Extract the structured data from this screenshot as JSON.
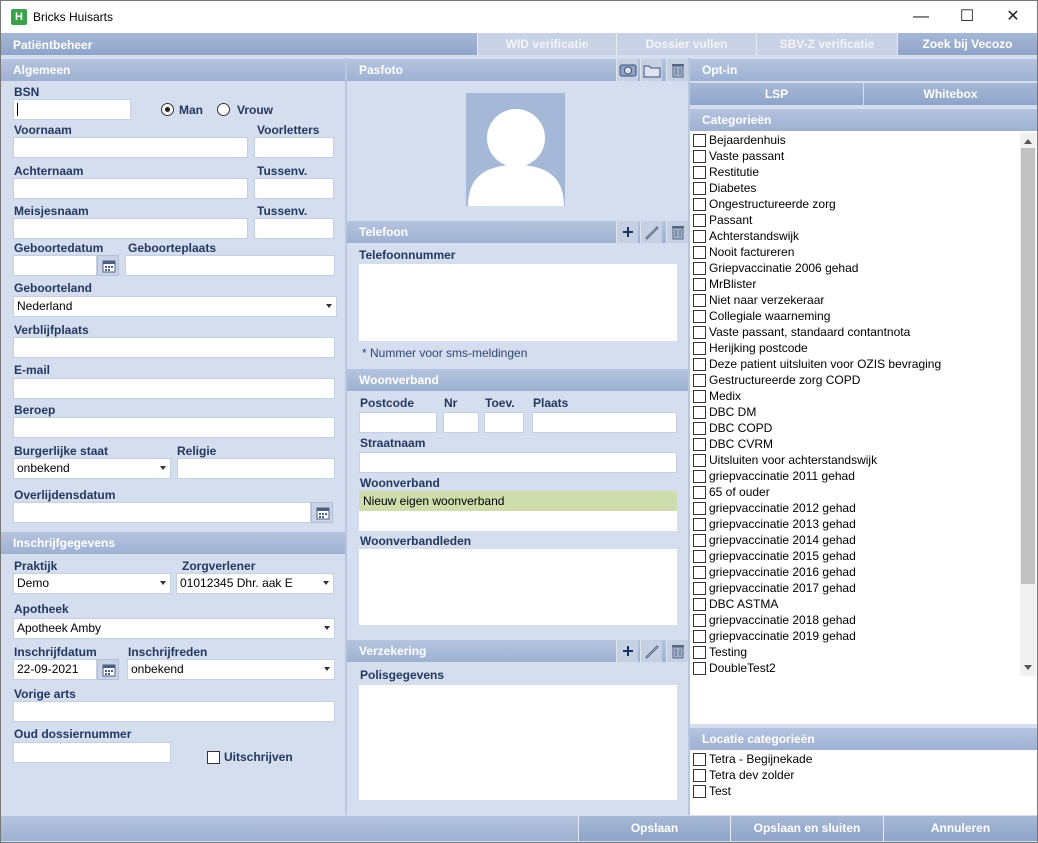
{
  "window": {
    "title": "Bricks Huisarts",
    "app_icon": "H",
    "minimize": "—",
    "maximize": "☐",
    "close": "✕"
  },
  "header": {
    "title": "Patiëntbeheer",
    "buttons": [
      "WID verificatie",
      "Dossier vullen",
      "SBV-Z verificatie",
      "Zoek bij Vecozo"
    ]
  },
  "algemeen": {
    "title": "Algemeen",
    "bsn_label": "BSN",
    "bsn_value": "",
    "gender_man": "Man",
    "gender_vrouw": "Vrouw",
    "voornaam_label": "Voornaam",
    "voorletters_label": "Voorletters",
    "achternaam_label": "Achternaam",
    "tussenv_label": "Tussenv.",
    "meisjesnaam_label": "Meisjesnaam",
    "tussenv2_label": "Tussenv.",
    "geboortedatum_label": "Geboortedatum",
    "geboorteplaats_label": "Geboorteplaats",
    "geboorteland_label": "Geboorteland",
    "geboorteland_value": "Nederland",
    "verblijfplaats_label": "Verblijfplaats",
    "email_label": "E-mail",
    "beroep_label": "Beroep",
    "burgerlijke_label": "Burgerlijke staat",
    "burgerlijke_value": "onbekend",
    "religie_label": "Religie",
    "overlijdensdatum_label": "Overlijdensdatum"
  },
  "inschrijf": {
    "title": "Inschrijfgegevens",
    "praktijk_label": "Praktijk",
    "praktijk_value": "Demo",
    "zorgverlener_label": "Zorgverlener",
    "zorgverlener_value": "01012345 Dhr. aak E",
    "apotheek_label": "Apotheek",
    "apotheek_value": "Apotheek Amby",
    "inschrijfdatum_label": "Inschrijfdatum",
    "inschrijfdatum_value": "22-09-2021",
    "inschrijfreden_label": "Inschrijfreden",
    "inschrijfreden_value": "onbekend",
    "vorige_arts_label": "Vorige arts",
    "oud_dossier_label": "Oud dossiernummer",
    "uitschrijven_label": "Uitschrijven"
  },
  "pasfoto": {
    "title": "Pasfoto"
  },
  "telefoon": {
    "title": "Telefoon",
    "nummer_label": "Telefoonnummer",
    "sms_note": "* Nummer voor sms-meldingen"
  },
  "woonverband": {
    "title": "Woonverband",
    "postcode_label": "Postcode",
    "nr_label": "Nr",
    "toev_label": "Toev.",
    "plaats_label": "Plaats",
    "straatnaam_label": "Straatnaam",
    "woonverband_label": "Woonverband",
    "woonverband_value": "Nieuw eigen woonverband",
    "leden_label": "Woonverbandleden"
  },
  "verzekering": {
    "title": "Verzekering",
    "polis_label": "Polisgegevens"
  },
  "optin": {
    "title": "Opt-in",
    "lsp": "LSP",
    "whitebox": "Whitebox"
  },
  "categorieen": {
    "title": "Categorieën",
    "items": [
      "Bejaardenhuis",
      "Vaste passant",
      "Restitutie",
      "Diabetes",
      "Ongestructureerde zorg",
      "Passant",
      "Achterstandswijk",
      "Nooit factureren",
      "Griepvaccinatie 2006 gehad",
      "MrBlister",
      "Niet naar verzekeraar",
      "Collegiale waarneming",
      "Vaste passant, standaard contantnota",
      "Herijking postcode",
      "Deze patient uitsluiten voor OZIS bevraging",
      "Gestructureerde zorg COPD",
      "Medix",
      "DBC DM",
      "DBC COPD",
      "DBC CVRM",
      "Uitsluiten voor achterstandswijk",
      "griepvaccinatie 2011 gehad",
      "65 of ouder",
      "griepvaccinatie 2012 gehad",
      "griepvaccinatie 2013 gehad",
      "griepvaccinatie 2014 gehad",
      "griepvaccinatie 2015 gehad",
      "griepvaccinatie 2016 gehad",
      "griepvaccinatie 2017 gehad",
      "DBC ASTMA",
      "griepvaccinatie 2018 gehad",
      "griepvaccinatie 2019 gehad",
      "Testing",
      "DoubleTest2"
    ]
  },
  "locatie": {
    "title": "Locatie categorieën",
    "items": [
      "Tetra - Begijnekade",
      "Tetra dev zolder",
      "Test"
    ]
  },
  "footer": {
    "opslaan": "Opslaan",
    "opslaan_sluiten": "Opslaan en sluiten",
    "annuleren": "Annuleren"
  }
}
